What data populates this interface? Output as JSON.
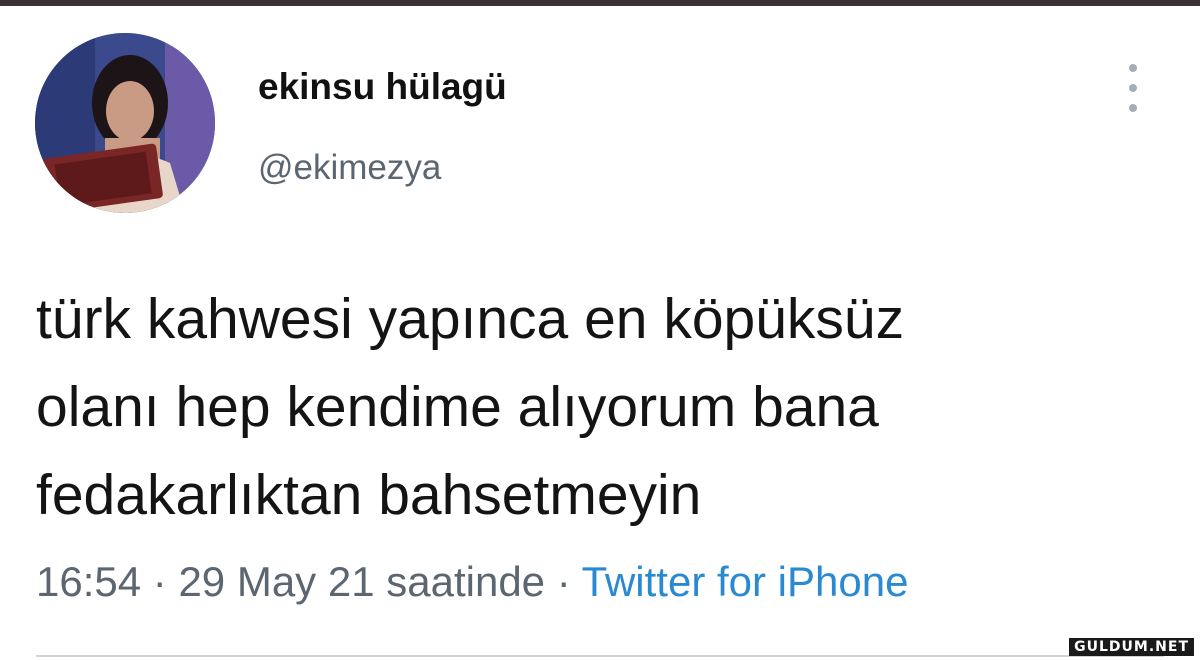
{
  "author": {
    "display_name": "ekinsu hülagü",
    "handle": "@ekimezya"
  },
  "tweet": {
    "text": "türk kahwesi yapınca en köpüksüz\nolanı hep kendime alıyorum bana\nfedakarlıktan bahsetmeyin"
  },
  "meta": {
    "time": "16:54",
    "date": "29 May 21 saatinde",
    "separator": "·",
    "source": "Twitter for iPhone"
  },
  "watermark": "GULDUM.NET",
  "icons": {
    "more": "more-vertical-icon"
  }
}
